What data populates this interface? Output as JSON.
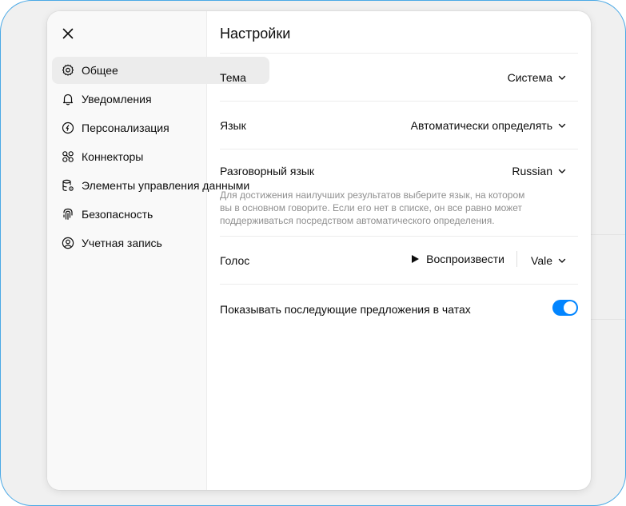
{
  "sidebar": {
    "close_icon": "close-icon",
    "items": [
      {
        "label": "Общее",
        "icon": "gear-icon",
        "active": true
      },
      {
        "label": "Уведомления",
        "icon": "bell-icon"
      },
      {
        "label": "Персонализация",
        "icon": "personalization-icon"
      },
      {
        "label": "Коннекторы",
        "icon": "connectors-icon"
      },
      {
        "label": "Элементы управления данными",
        "icon": "database-icon"
      },
      {
        "label": "Безопасность",
        "icon": "fingerprint-icon"
      },
      {
        "label": "Учетная запись",
        "icon": "user-circle-icon"
      }
    ]
  },
  "settings": {
    "title": "Настройки",
    "theme": {
      "label": "Тема",
      "value": "Система"
    },
    "language": {
      "label": "Язык",
      "value": "Автоматически определять"
    },
    "spoken_language": {
      "label": "Разговорный язык",
      "value": "Russian",
      "help": "Для достижения наилучших результатов выберите язык, на котором вы в основном говорите. Если его нет в списке, он все равно может поддерживаться посредством автоматического определения."
    },
    "voice": {
      "label": "Голос",
      "play_label": "Воспроизвести",
      "value": "Vale"
    },
    "follow_up": {
      "label": "Показывать последующие предложения в чатах",
      "enabled": true
    }
  },
  "colors": {
    "accent": "#0285ff",
    "frame_border": "#4aa9e6"
  }
}
